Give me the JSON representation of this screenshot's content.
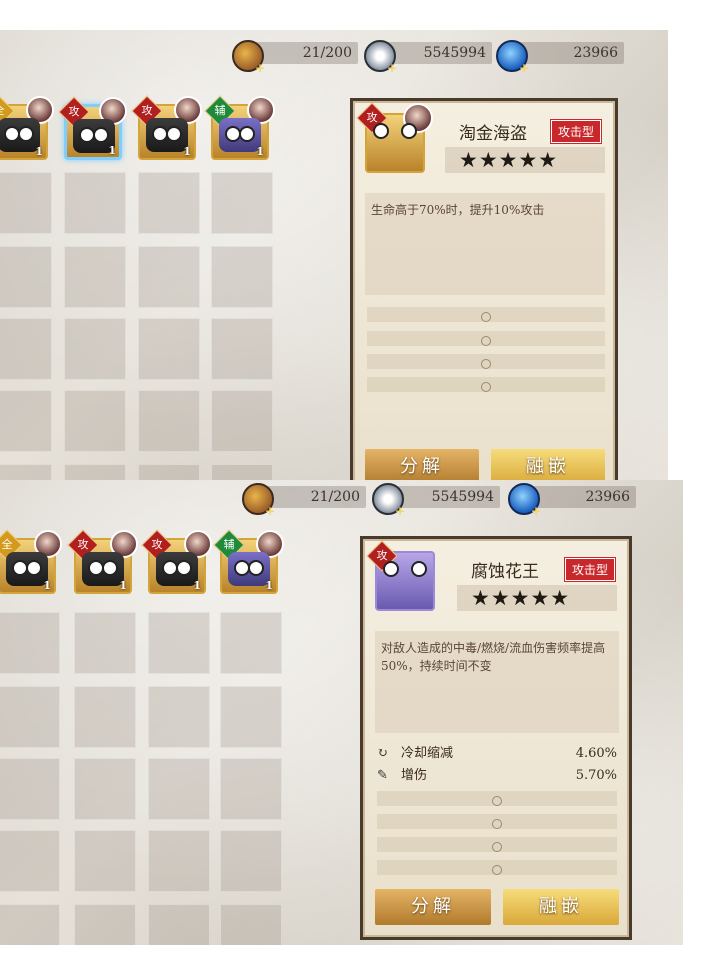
{
  "resources": {
    "stamina": "21/200",
    "coins": "5545994",
    "gems": "23966",
    "stamina_icon": "stamina-scroll-icon",
    "coin_icon": "triangle-coin-icon",
    "gem_icon": "blue-gem-icon"
  },
  "panel1": {
    "cards": [
      {
        "badge": "全",
        "level": "1",
        "badge_color": "#d39a1c",
        "face": "black"
      },
      {
        "badge": "攻",
        "level": "1",
        "badge_color": "#b21f1f",
        "face": "black",
        "selected": true
      },
      {
        "badge": "攻",
        "level": "1",
        "badge_color": "#b21f1f",
        "face": "black"
      },
      {
        "badge": "辅",
        "level": "1",
        "badge_color": "#1f8a3a",
        "face": "purple"
      }
    ],
    "detail": {
      "icon_badge": "攻",
      "name": "淘金海盗",
      "type": "攻击型",
      "stars": "★★★★★",
      "description": "生命高于70%时，提升10%攻击",
      "decompose_label": "分解",
      "embed_label": "融嵌"
    }
  },
  "panel2": {
    "cards": [
      {
        "badge": "全",
        "level": "1",
        "badge_color": "#d39a1c",
        "face": "black"
      },
      {
        "badge": "攻",
        "level": "1",
        "badge_color": "#b21f1f",
        "face": "black"
      },
      {
        "badge": "攻",
        "level": "1",
        "badge_color": "#b21f1f",
        "face": "black"
      },
      {
        "badge": "辅",
        "level": "1",
        "badge_color": "#1f8a3a",
        "face": "purple"
      }
    ],
    "detail": {
      "icon_badge": "攻",
      "name": "腐蚀花王",
      "type": "攻击型",
      "stars": "★★★★★",
      "description": "对敌人造成的中毒/燃烧/流血伤害频率提高50%，持续时间不变",
      "stats": [
        {
          "icon": "cooldown-icon",
          "label": "冷却缩减",
          "value": "4.60%"
        },
        {
          "icon": "damage-boost-icon",
          "label": "增伤",
          "value": "5.70%"
        }
      ],
      "decompose_label": "分解",
      "embed_label": "融嵌"
    }
  }
}
